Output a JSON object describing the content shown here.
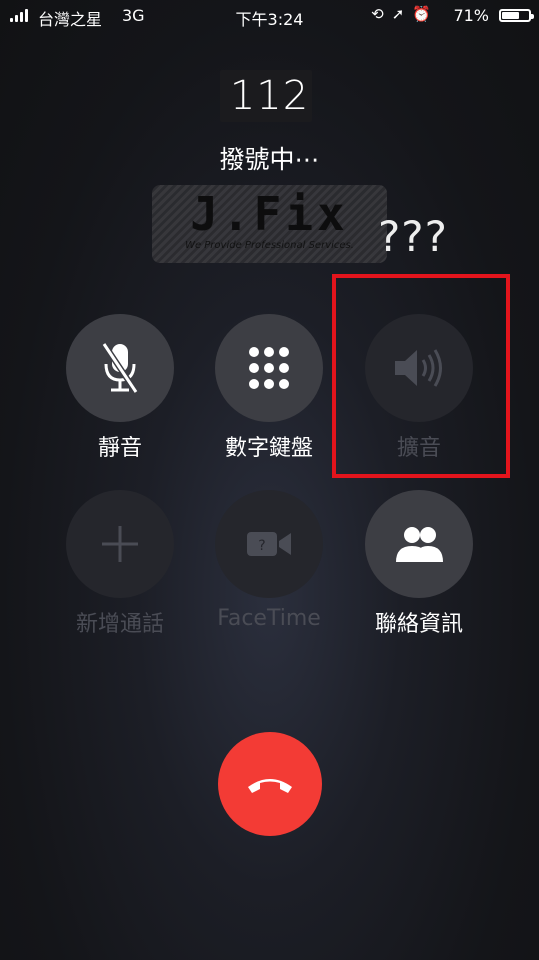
{
  "status_bar": {
    "carrier": "台灣之星",
    "network": "3G",
    "time": "下午3:24",
    "battery_percent": "71%",
    "battery_level": 0.71,
    "icons": [
      "rotation-lock-icon",
      "location-icon",
      "alarm-icon"
    ]
  },
  "call": {
    "number": "112",
    "status": "撥號中⋯"
  },
  "watermark": {
    "title": "J.Fix",
    "subtitle": "We Provide Professional Services."
  },
  "annotation": {
    "question": "???",
    "highlight_color": "#e3141c"
  },
  "buttons": {
    "mute": "靜音",
    "keypad": "數字鍵盤",
    "speaker": "擴音",
    "add_call": "新增通話",
    "facetime": "FaceTime",
    "contacts": "聯絡資訊"
  },
  "colors": {
    "end_call": "#f33b35",
    "button_active": "#3d3e44",
    "button_disabled": "#25262c"
  }
}
